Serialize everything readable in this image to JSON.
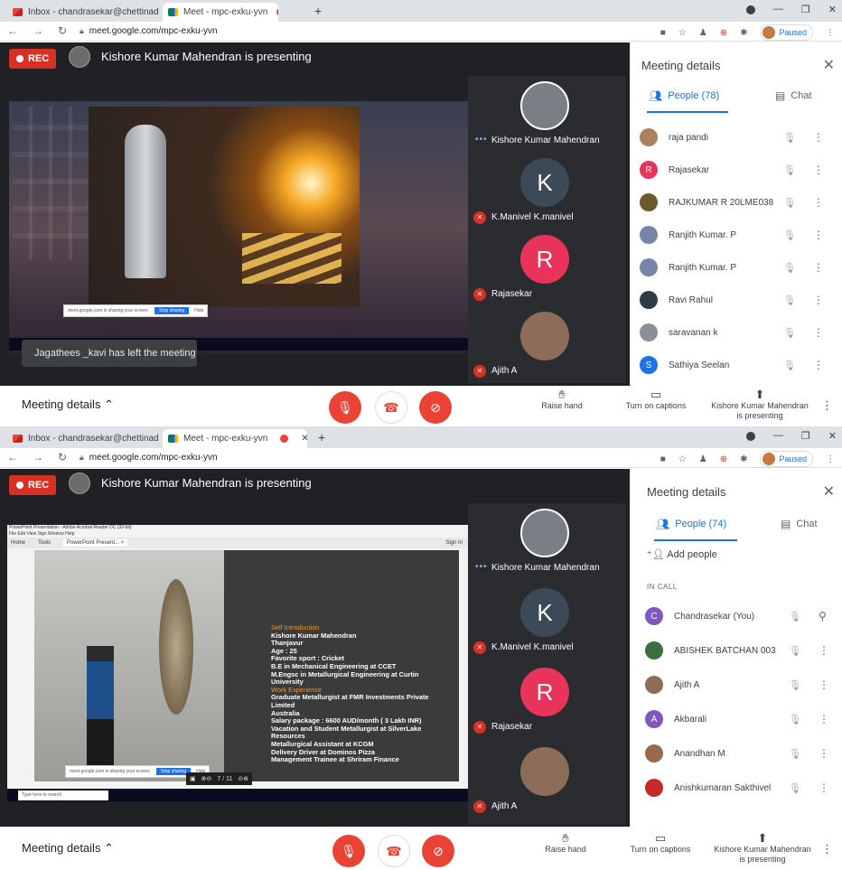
{
  "colors": {
    "accent": "#1a73e8",
    "danger": "#ea4335",
    "stage": "#202124"
  },
  "shots": [
    {
      "tabs": [
        "Inbox - chandrasekar@chettinad",
        "Meet - mpc-exku-yvn"
      ],
      "url": "meet.google.com/mpc-exku-yvn",
      "paused": "Paused",
      "rec": "REC",
      "presenting": "Kishore Kumar Mahendran is presenting",
      "notice": "Jagathees _kavi has left the meeting",
      "tiles": [
        {
          "name": "Kishore Kumar Mahendran",
          "letter": "",
          "color": "#7a7f85"
        },
        {
          "name": "K.Manivel K.manivel",
          "letter": "K",
          "color": "#3c4a57"
        },
        {
          "name": "Rajasekar",
          "letter": "R",
          "color": "#e8335b"
        },
        {
          "name": "Ajith A",
          "letter": "",
          "color": "#8c6d5a"
        }
      ],
      "panel": {
        "title": "Meeting details",
        "people_tab": "People (78)",
        "chat_tab": "Chat",
        "people": [
          {
            "name": "raja pandi",
            "letter": "",
            "color": "#a98060"
          },
          {
            "name": "Rajasekar",
            "letter": "R",
            "color": "#e8335b"
          },
          {
            "name": "RAJKUMAR R 20LME038",
            "letter": "",
            "color": "#6b5b2b"
          },
          {
            "name": "Ranjith Kumar. P",
            "letter": "",
            "color": "#7885a8"
          },
          {
            "name": "Ranjith Kumar. P",
            "letter": "",
            "color": "#7885a8"
          },
          {
            "name": "Ravi Rahul",
            "letter": "",
            "color": "#2d3b44"
          },
          {
            "name": "saravanan k",
            "letter": "",
            "color": "#8a9196"
          },
          {
            "name": "Sathiya Seelan",
            "letter": "S",
            "color": "#1a73e8"
          }
        ]
      },
      "bottom": {
        "details": "Meeting details",
        "raise": "Raise hand",
        "captions": "Turn on captions",
        "presenter": "Kishore Kumar Mahendran",
        "presenter2": "is presenting"
      }
    },
    {
      "tabs": [
        "Inbox - chandrasekar@chettinad",
        "Meet - mpc-exku-yvn"
      ],
      "url": "meet.google.com/mpc-exku-yvn",
      "paused": "Paused",
      "rec": "REC",
      "presenting": "Kishore Kumar Mahendran is presenting",
      "tiles": [
        {
          "name": "Kishore Kumar Mahendran",
          "letter": "",
          "color": "#7a7f85"
        },
        {
          "name": "K.Manivel K.manivel",
          "letter": "K",
          "color": "#3c4a57"
        },
        {
          "name": "Rajasekar",
          "letter": "R",
          "color": "#e8335b"
        },
        {
          "name": "Ajith A",
          "letter": "",
          "color": "#8c6d5a"
        }
      ],
      "slide": {
        "window_title": "PowerPoint Presentation - Adobe Acrobat Reader DC (32-bit)",
        "menu": "File  Edit  View  Sign  Window  Help",
        "home": "Home",
        "tools": "Tools",
        "doc_tab": "PowerPoint Present... ×",
        "sign_in": "Sign In",
        "page": "7 / 11",
        "search": "Type here to search",
        "lines": [
          {
            "t": "Self Introduction",
            "h": true
          },
          {
            "t": "Kishore Kumar Mahendran",
            "h": false
          },
          {
            "t": "Thanjavur",
            "h": false
          },
          {
            "t": "Age : 25",
            "h": false
          },
          {
            "t": "Favorite sport : Cricket",
            "h": false
          },
          {
            "t": "B.E in Mechanical Engineering at CCET",
            "h": false
          },
          {
            "t": "M.Engsc in Metallurgical Engineering at Curtin",
            "h": false
          },
          {
            "t": "University",
            "h": false
          },
          {
            "t": "Work Experience",
            "h": true
          },
          {
            "t": "Graduate Metallurgist at FMR Investments Private",
            "h": false
          },
          {
            "t": "Limited",
            "h": false
          },
          {
            "t": "Australia",
            "h": false
          },
          {
            "t": "Salary package : 6600 AUD/month ( 3 Lakh INR)",
            "h": false
          },
          {
            "t": "Vacation and Student Metallurgist at SilverLake",
            "h": false
          },
          {
            "t": "Resources",
            "h": false
          },
          {
            "t": "Metallurgical Assistant at KCGM",
            "h": false
          },
          {
            "t": "Delivery Driver at Dominos Pizza",
            "h": false
          },
          {
            "t": "Management Trainee at Shriram Finance",
            "h": false
          }
        ]
      },
      "panel": {
        "title": "Meeting details",
        "people_tab": "People (74)",
        "chat_tab": "Chat",
        "add_people": "Add people",
        "in_call": "IN CALL",
        "people": [
          {
            "name": "Chandrasekar (You)",
            "letter": "C",
            "color": "#7e57c2"
          },
          {
            "name": "ABISHEK BATCHAN 003",
            "letter": "",
            "color": "#3d6e3b"
          },
          {
            "name": "Ajith A",
            "letter": "",
            "color": "#8c6d5a"
          },
          {
            "name": "Akbarali",
            "letter": "A",
            "color": "#7e57c2"
          },
          {
            "name": "Anandhan M",
            "letter": "",
            "color": "#9a6b4a"
          },
          {
            "name": "Anishkumaran Sakthivel",
            "letter": "",
            "color": "#c62828"
          }
        ]
      },
      "bottom": {
        "details": "Meeting details",
        "raise": "Raise hand",
        "captions": "Turn on captions",
        "presenter": "Kishore Kumar Mahendran",
        "presenter2": "is presenting"
      }
    }
  ]
}
